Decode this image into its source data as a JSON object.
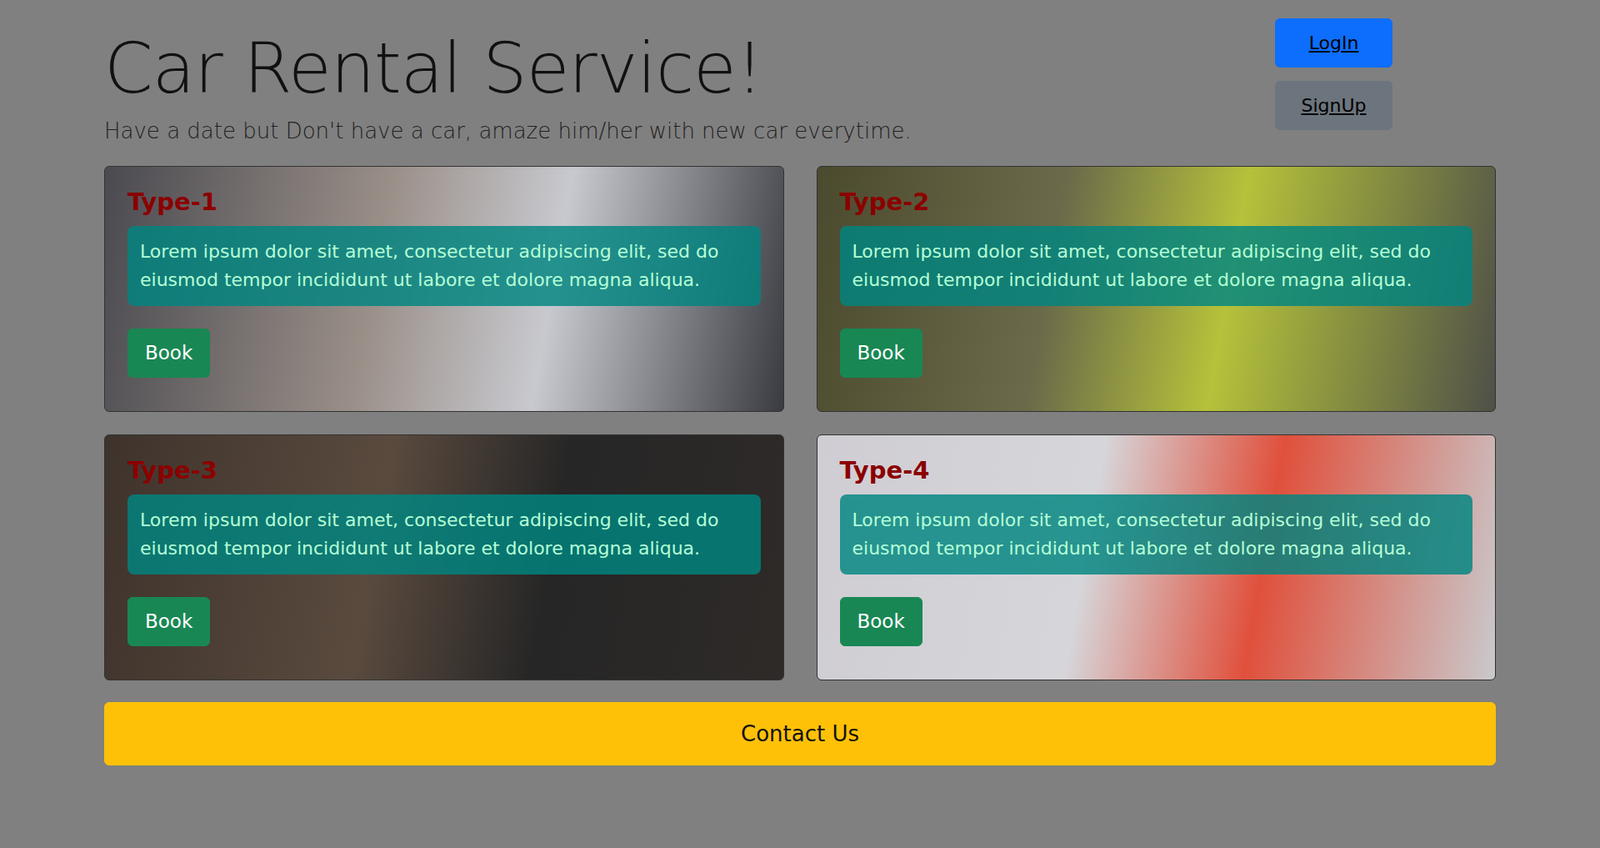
{
  "header": {
    "title": "Car Rental Service!",
    "subtitle": "Have a date but Don't have a car, amaze him/her with new car everytime."
  },
  "auth_buttons": [
    {
      "label": "LogIn",
      "kind": "primary"
    },
    {
      "label": "SignUp",
      "kind": "secondary"
    }
  ],
  "cards": [
    {
      "title": "Type-1",
      "text": "Lorem ipsum dolor sit amet, consectetur adipiscing elit, sed do eiusmod tempor incididunt ut labore et dolore magna aliqua.",
      "button": "Book"
    },
    {
      "title": "Type-2",
      "text": "Lorem ipsum dolor sit amet, consectetur adipiscing elit, sed do eiusmod tempor incididunt ut labore et dolore magna aliqua.",
      "button": "Book"
    },
    {
      "title": "Type-3",
      "text": "Lorem ipsum dolor sit amet, consectetur adipiscing elit, sed do eiusmod tempor incididunt ut labore et dolore magna aliqua.",
      "button": "Book"
    },
    {
      "title": "Type-4",
      "text": "Lorem ipsum dolor sit amet, consectetur adipiscing elit, sed do eiusmod tempor incididunt ut labore et dolore magna aliqua.",
      "button": "Book"
    }
  ],
  "contact_button": "Contact Us"
}
